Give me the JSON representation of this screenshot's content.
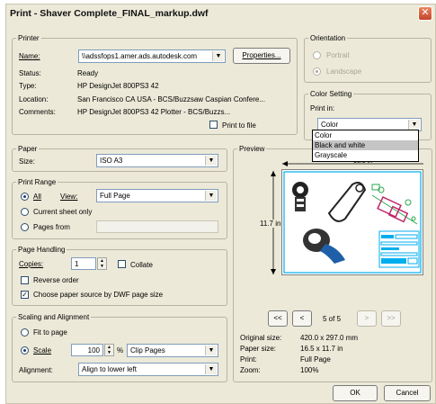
{
  "window": {
    "title": "Print - Shaver Complete_FINAL_markup.dwf"
  },
  "printer": {
    "legend": "Printer",
    "name_label": "Name:",
    "name_value": "\\\\adssfops1.amer.ads.autodesk.com",
    "properties_label": "Properties...",
    "status_label": "Status:",
    "status_value": "Ready",
    "type_label": "Type:",
    "type_value": "HP DesignJet 800PS3 42",
    "location_label": "Location:",
    "location_value": "San Francisco CA USA - BCS/Buzzsaw Caspian Confere...",
    "comments_label": "Comments:",
    "comments_value": "HP DesignJet 800PS3 42 Plotter - BCS/Buzzs...",
    "print_to_file_label": "Print to file"
  },
  "orientation": {
    "legend": "Orientation",
    "portrait_label": "Portrait",
    "landscape_label": "Landscape"
  },
  "color_setting": {
    "legend": "Color Setting",
    "print_in_label": "Print in:",
    "selected": "Color",
    "options": [
      "Color",
      "Black and white",
      "Grayscale"
    ],
    "highlighted_index": 1
  },
  "paper": {
    "legend": "Paper",
    "size_label": "Size:",
    "size_value": "ISO A3"
  },
  "print_range": {
    "legend": "Print Range",
    "all_label": "All",
    "view_label": "View:",
    "view_value": "Full Page",
    "current_sheet_label": "Current sheet only",
    "pages_from_label": "Pages from",
    "pages_from_value": ""
  },
  "page_handling": {
    "legend": "Page Handling",
    "copies_label": "Copies:",
    "copies_value": "1",
    "collate_label": "Collate",
    "reverse_order_label": "Reverse order",
    "choose_source_label": "Choose paper source by DWF page size",
    "choose_source_checked": true
  },
  "scaling": {
    "legend": "Scaling and Alignment",
    "fit_label": "Fit to page",
    "scale_label": "Scale",
    "scale_value": "100",
    "percent_label": "%",
    "clip_value": "Clip Pages",
    "alignment_label": "Alignment:",
    "alignment_value": "Align to lower left"
  },
  "preview": {
    "legend": "Preview",
    "width_dim": "16.5 in",
    "height_dim": "11.7 in",
    "nav_first": "<<",
    "nav_prev": "<",
    "page_indicator": "5 of 5",
    "nav_next": ">",
    "nav_last": ">>",
    "info": [
      {
        "label": "Original size:",
        "value": "420.0 x 297.0 mm"
      },
      {
        "label": "Paper size:",
        "value": "16.5 x 11.7 in"
      },
      {
        "label": "Print:",
        "value": "Full Page"
      },
      {
        "label": "Zoom:",
        "value": "100%"
      }
    ]
  },
  "buttons": {
    "ok": "OK",
    "cancel": "Cancel"
  },
  "colors": {
    "dialog_bg": "#ece9d8",
    "close_red": "#c1462a",
    "accent_cyan": "#00aeef"
  }
}
